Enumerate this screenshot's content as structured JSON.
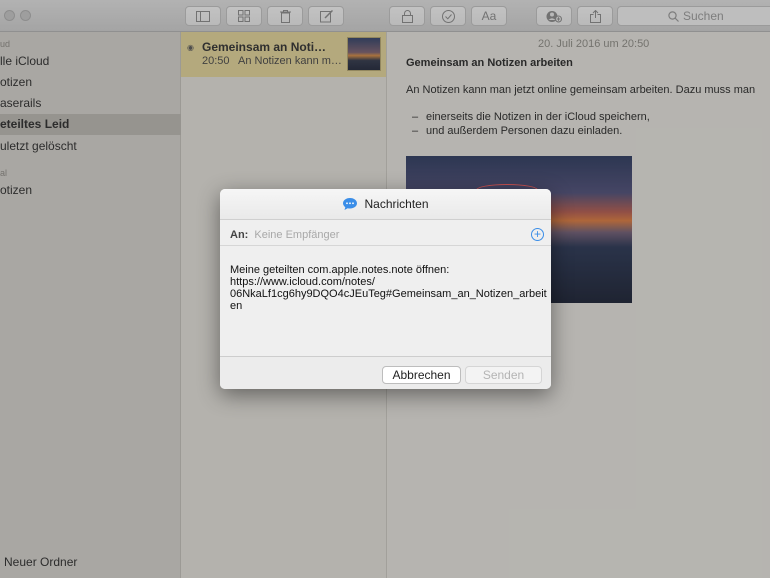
{
  "toolbar": {
    "search_placeholder": "Suchen",
    "font_button_label": "Aa"
  },
  "sidebar": {
    "sections": [
      {
        "label": "ud"
      },
      {
        "label": "al"
      }
    ],
    "items": [
      {
        "label": "lle iCloud"
      },
      {
        "label": "otizen"
      },
      {
        "label": "aserails"
      },
      {
        "label": "eteiltes Leid",
        "selected": true
      },
      {
        "label": "uletzt gelöscht"
      },
      {
        "label": "otizen"
      }
    ],
    "new_folder_label": "Neuer Ordner"
  },
  "note_list": {
    "items": [
      {
        "title": "Gemeinsam an Noti…",
        "time": "20:50",
        "preview": "An Notizen kann m…"
      }
    ]
  },
  "editor": {
    "date": "20. Juli 2016 um 20:50",
    "title": "Gemeinsam an Notizen arbeiten",
    "body": "An Notizen kann man jetzt online gemeinsam arbeiten. Dazu muss man",
    "bullets": [
      "einerseits die Notizen in der iCloud speichern,",
      "und außerdem Personen dazu einladen."
    ]
  },
  "sheet": {
    "title": "Nachrichten",
    "to_label": "An:",
    "to_placeholder": "Keine Empfänger",
    "message_lines": [
      "Meine geteilten com.apple.notes.note öffnen:",
      "https://www.icloud.com/notes/",
      "06NkaLf1cg6hy9DQO4cJEuTeg#Gemeinsam_an_Notizen_arbeit",
      "en"
    ],
    "cancel_label": "Abbrechen",
    "send_label": "Senden"
  },
  "colors": {
    "note_highlight": "#e9d99a",
    "accent_blue": "#3b8ee8"
  }
}
